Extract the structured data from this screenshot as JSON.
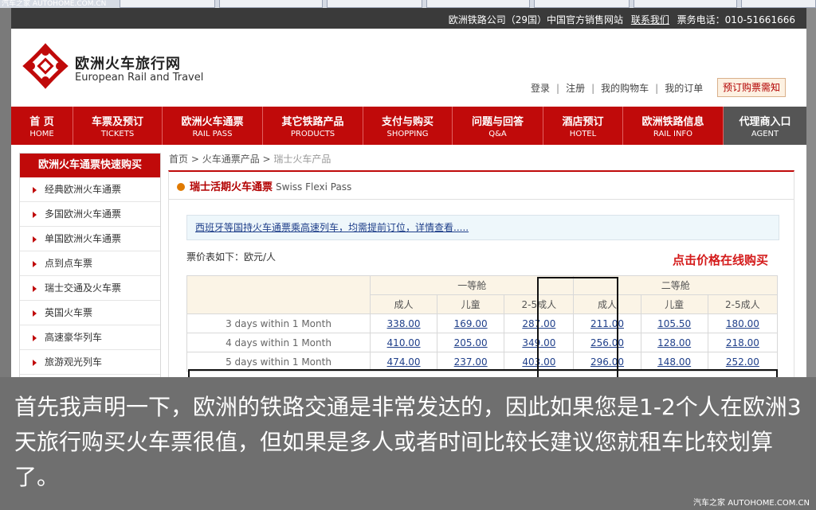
{
  "browser": {
    "watermark": "汽车之家 AUTOHOME.COM.CN"
  },
  "topbar": {
    "site_text": "欧洲铁路公司（29国）中国官方销售网站",
    "contact_link": "联系我们",
    "phone_text": "票务电话：010-51661666"
  },
  "header": {
    "logo_cn": "欧洲火车旅行网",
    "logo_en": "European Rail and Travel",
    "links": [
      "登录",
      "注册",
      "我的购物车",
      "我的订单"
    ],
    "order_button": "预订购票需知"
  },
  "nav": [
    {
      "cn": "首 页",
      "en": "HOME"
    },
    {
      "cn": "车票及预订",
      "en": "TICKETS"
    },
    {
      "cn": "欧洲火车通票",
      "en": "RAIL PASS"
    },
    {
      "cn": "其它铁路产品",
      "en": "PRODUCTS"
    },
    {
      "cn": "支付与购买",
      "en": "SHOPPING"
    },
    {
      "cn": "问题与回答",
      "en": "Q&A"
    },
    {
      "cn": "酒店预订",
      "en": "HOTEL"
    },
    {
      "cn": "欧洲铁路信息",
      "en": "RAIL INFO"
    },
    {
      "cn": "代理商入口",
      "en": "AGENT"
    }
  ],
  "sidebar": {
    "title": "欧洲火车通票快速购买",
    "items": [
      "经典欧洲火车通票",
      "多国欧洲火车通票",
      "单国欧洲火车通票",
      "点到点车票",
      "瑞士交通及火车票",
      "英国火车票",
      "高速豪华列车",
      "旅游观光列车"
    ]
  },
  "breadcrumb": {
    "home": "首页",
    "sep": " > ",
    "level1": "火车通票产品",
    "current": "瑞士火车产品"
  },
  "product": {
    "title_cn": "瑞士活期火车通票",
    "title_en": "Swiss Flexi Pass",
    "notice": "西班牙等国持火车通票乘高速列车，均需提前订位，详情查看.....",
    "price_label": "票价表如下：欧元/人",
    "click_buy": "点击价格在线购买",
    "class1": "一等舱",
    "class2": "二等舱",
    "col_adult": "成人",
    "col_child": "儿童",
    "col_group": "2-5成人",
    "rows": [
      {
        "label": "3 days within 1 Month",
        "prices": [
          "338.00",
          "169.00",
          "287.00",
          "211.00",
          "105.50",
          "180.00"
        ]
      },
      {
        "label": "4 days within 1 Month",
        "prices": [
          "410.00",
          "205.00",
          "349.00",
          "256.00",
          "128.00",
          "218.00"
        ]
      },
      {
        "label": "5 days within 1 Month",
        "prices": [
          "474.00",
          "237.00",
          "403.00",
          "296.00",
          "148.00",
          "252.00"
        ]
      }
    ]
  },
  "caption": {
    "text": "首先我声明一下，欧洲的铁路交通是非常发达的，因此如果您是1-2个人在欧洲3天旅行购买火车票很值，但如果是多人或者时间比较长建议您就租车比较划算了。",
    "credit": "汽车之家 AUTOHOME.COM.CN"
  }
}
